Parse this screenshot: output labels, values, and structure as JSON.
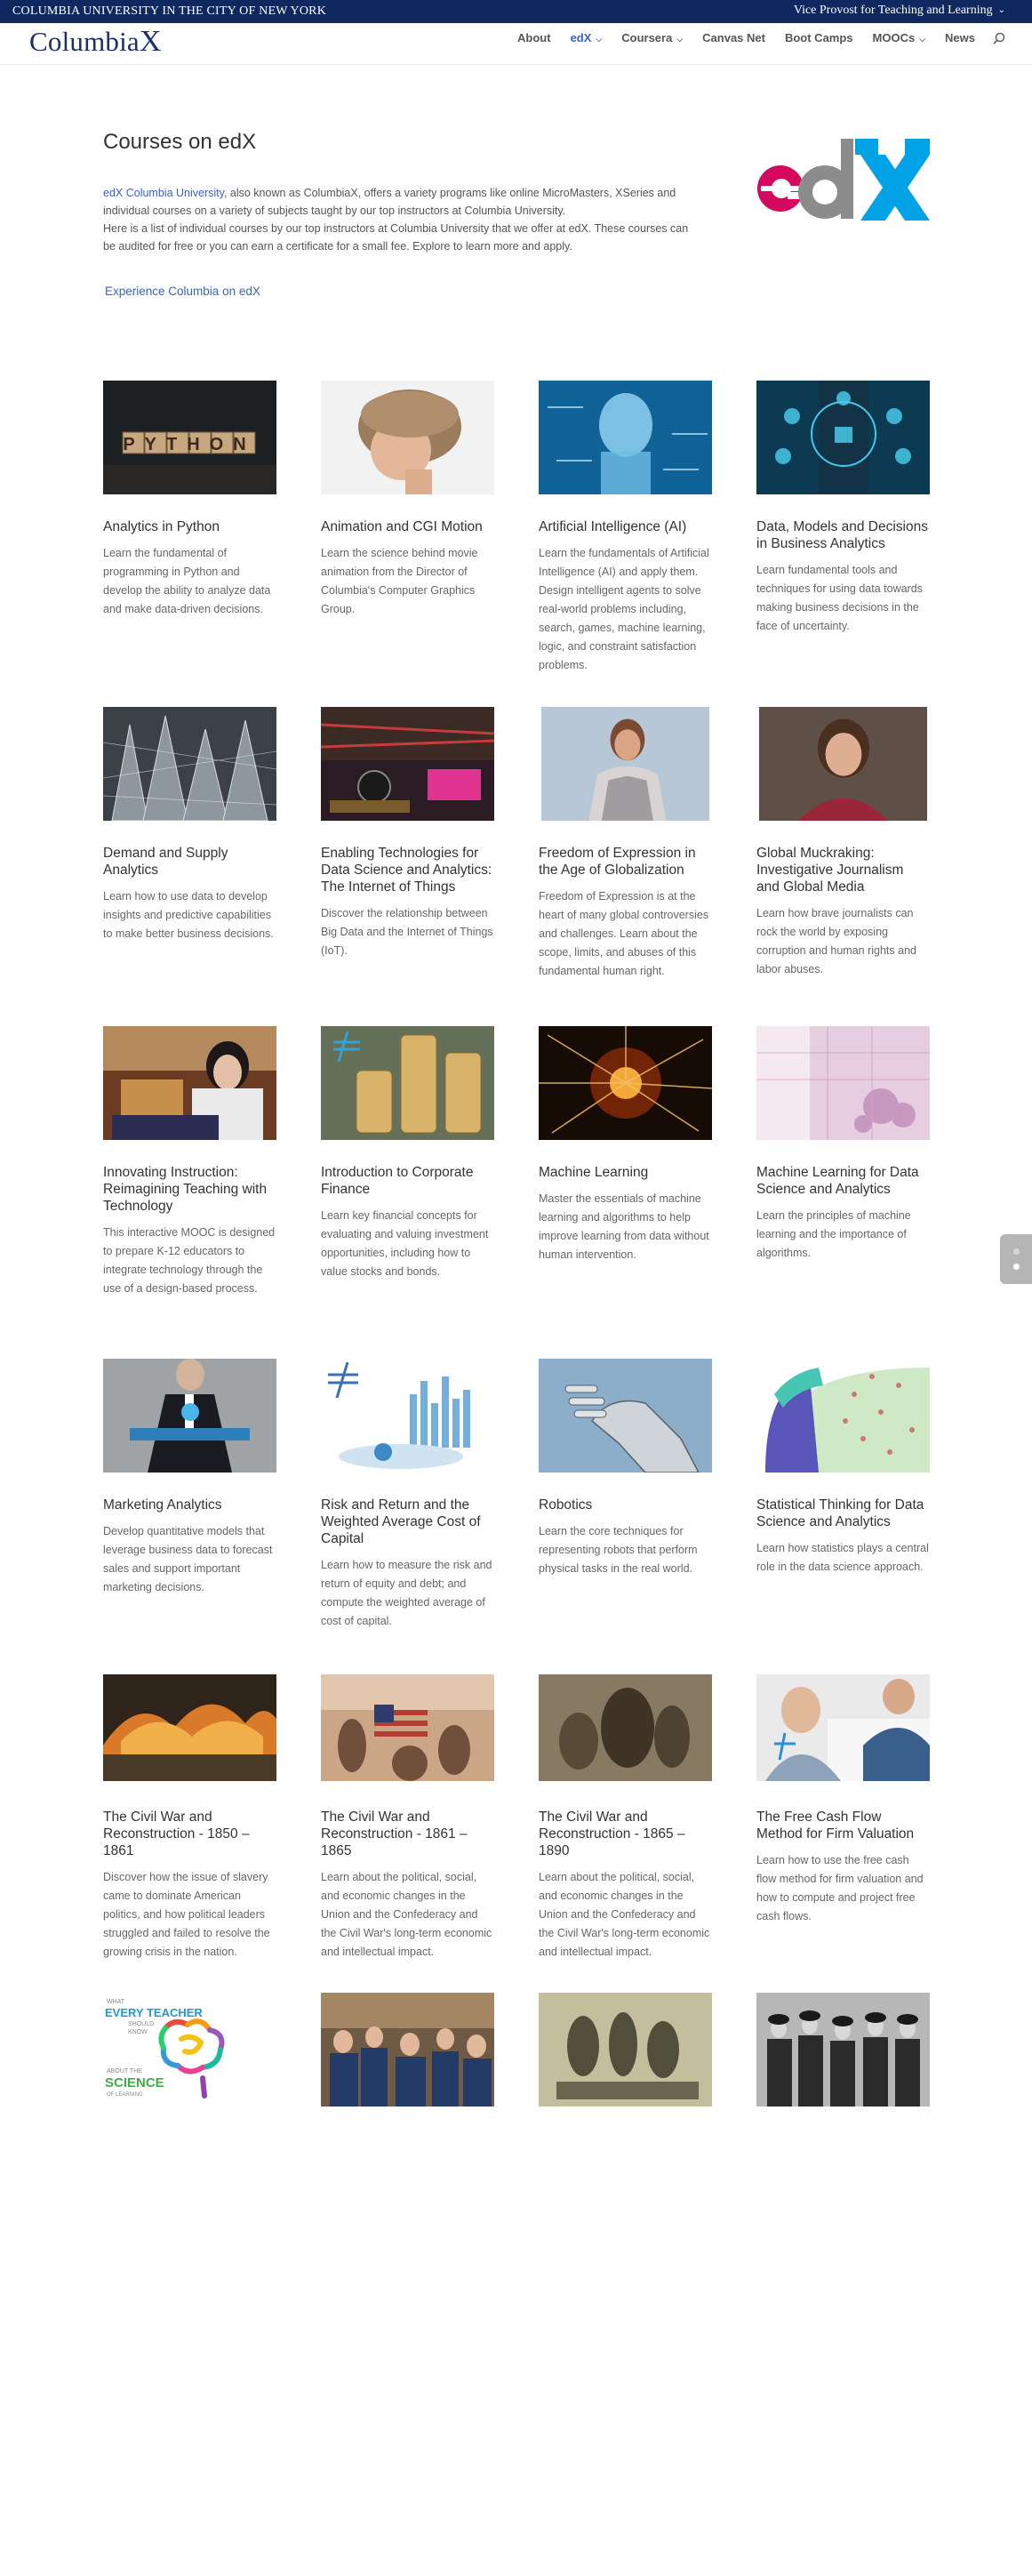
{
  "topbar": {
    "left_text": "COLUMBIA UNIVERSITY IN THE CITY OF NEW YORK",
    "right_text": "Vice Provost for Teaching and Learning"
  },
  "header": {
    "logo_main": "Columbia",
    "logo_x": "X",
    "nav": [
      {
        "label": "About"
      },
      {
        "label": "edX"
      },
      {
        "label": "Coursera"
      },
      {
        "label": "Canvas Net"
      },
      {
        "label": "Boot Camps"
      },
      {
        "label": "MOOCs"
      },
      {
        "label": "News"
      }
    ]
  },
  "intro": {
    "title": "Courses on edX",
    "link_text": "edX Columbia University",
    "text_1": ", also known as ColumbiaX, offers a variety programs like online MicroMasters, XSeries and individual courses on a variety of subjects taught by our top instructors at Columbia University.",
    "text_2": "Here is a list of individual courses by our top instructors at Columbia University that we offer at edX. These courses can be audited for free or you can earn a certificate for a small fee. Explore to learn more and apply.",
    "cta": "Experience Columbia on edX",
    "edx_logo_text": "edX"
  },
  "courses": [
    {
      "title": "Analytics in Python",
      "desc": "Learn the fundamental of programming in Python and develop the ability to analyze data and make data-driven decisions.",
      "thumb_text": "PYTHON"
    },
    {
      "title": "Animation and CGI Motion",
      "desc": "Learn the science behind movie animation from the Director of Columbia's Computer Graphics Group."
    },
    {
      "title": "Artificial Intelligence (AI)",
      "desc": "Learn the fundamentals of Artificial Intelligence (AI) and apply them. Design intelligent agents to solve real-world problems including, search, games, machine learning, logic, and constraint satisfaction problems."
    },
    {
      "title": "Data, Models and Decisions in Business Analytics",
      "desc": "Learn fundamental tools and techniques for using data towards making business decisions in the face of uncertainty."
    },
    {
      "title": "Demand and Supply Analytics",
      "desc": "Learn how to use data to develop insights and predictive capabilities to make better business decisions."
    },
    {
      "title": "Enabling Technologies for Data Science and Analytics: The Internet of Things",
      "desc": "Discover the relationship between Big Data and the Internet of Things (IoT)."
    },
    {
      "title": "Freedom of Expression in the Age of Globalization",
      "desc": "Freedom of Expression is at the heart of many global controversies and challenges. Learn about the scope, limits, and abuses of this fundamental human right."
    },
    {
      "title": "Global Muckraking: Investigative Journalism and Global Media",
      "desc": "Learn how brave journalists can rock the world by exposing corruption and human rights and labor abuses."
    },
    {
      "title": "Innovating Instruction: Reimagining Teaching with Technology",
      "desc": "This interactive MOOC is designed to prepare K-12 educators to integrate technology through the use of a design-based process."
    },
    {
      "title": "Introduction to Corporate Finance",
      "desc": "Learn key financial concepts for evaluating and valuing investment opportunities, including how to value stocks and bonds."
    },
    {
      "title": "Machine Learning",
      "desc": "Master the essentials of machine learning and algorithms to help improve learning from data without human intervention."
    },
    {
      "title": "Machine Learning for Data Science and Analytics",
      "desc": "Learn the principles of machine learning and the importance of algorithms."
    },
    {
      "title": "Marketing Analytics",
      "desc": "Develop quantitative models that leverage business data to forecast sales and support important marketing decisions."
    },
    {
      "title": "Risk and Return and the Weighted Average Cost of Capital",
      "desc": "Learn how to measure the risk and return of equity and debt; and compute the weighted average of cost of capital."
    },
    {
      "title": "Robotics",
      "desc": "Learn the core techniques for representing robots that perform physical tasks in the real world."
    },
    {
      "title": "Statistical Thinking for Data Science and Analytics",
      "desc": "Learn how statistics plays a central role in the data science approach."
    },
    {
      "title": "The Civil War and Reconstruction - 1850 – 1861",
      "desc": "Discover how the issue of slavery came to dominate American politics, and how political leaders struggled and failed to resolve the growing crisis in the nation."
    },
    {
      "title": "The Civil War and Reconstruction - 1861 – 1865",
      "desc": "Learn about the political, social, and economic changes in the Union and the Confederacy and the Civil War's long-term economic and intellectual impact."
    },
    {
      "title": "The Civil War and Reconstruction - 1865 – 1890",
      "desc": "Learn about the political, social, and economic changes in the Union and the Confederacy and the Civil War's long-term economic and intellectual impact."
    },
    {
      "title": "The Free Cash Flow Method for Firm Valuation",
      "desc": "Learn how to use the free cash flow method for firm valuation and how to compute and project free cash flows."
    },
    {
      "title": "",
      "desc": "",
      "thumb_lines": [
        "WHAT",
        "EVERY TEACHER",
        "SHOULD",
        "KNOW",
        "ABOUT THE",
        "SCIENCE",
        "OF LEARNING"
      ]
    },
    {
      "title": "",
      "desc": ""
    },
    {
      "title": "",
      "desc": ""
    },
    {
      "title": "",
      "desc": ""
    }
  ]
}
